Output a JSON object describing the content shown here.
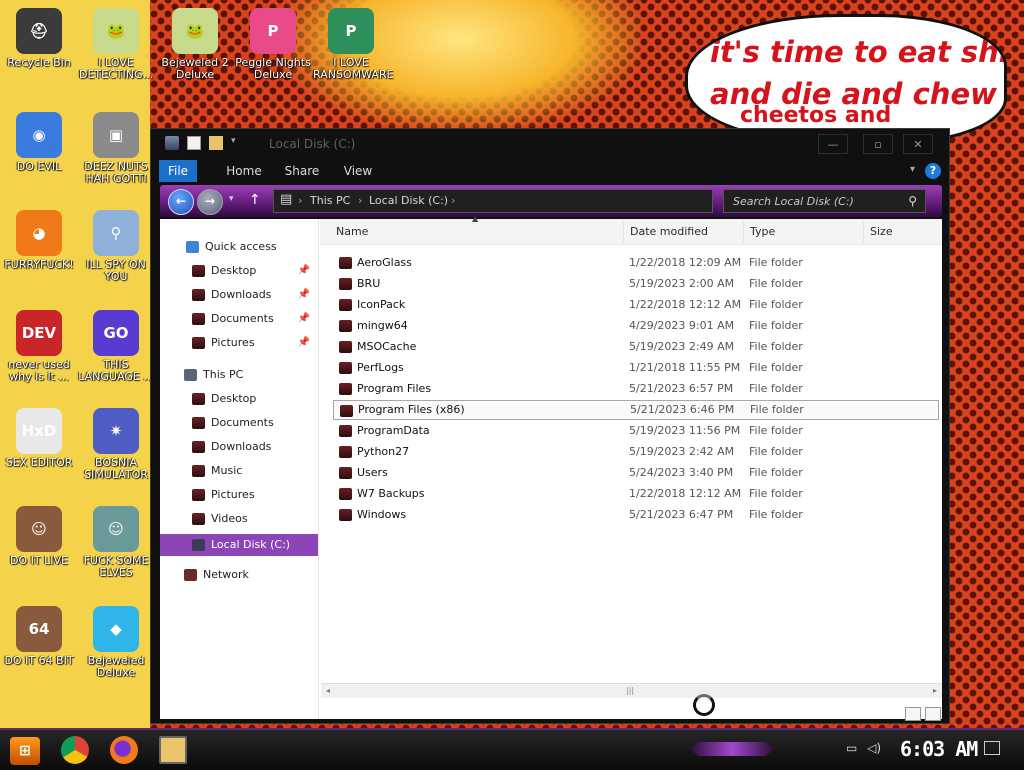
{
  "speech_bubble": {
    "line1": "it's time to eat shit",
    "line2": "and die and chew",
    "line3": "cheetos and"
  },
  "desktop_icons": [
    {
      "label": "Recycle Bin",
      "icon": "recycle-bin-icon",
      "color": "#3b3b3b",
      "glyph": "⛑"
    },
    {
      "label": "I LOVE DETECTING...",
      "icon": "frog-meme-icon",
      "color": "#c7d98a",
      "glyph": "🐸"
    },
    {
      "label": "Bejeweled 2 Deluxe",
      "icon": "bejeweled-icon",
      "color": "#c7d98a",
      "glyph": "🐸"
    },
    {
      "label": "Peggle Nights Deluxe",
      "icon": "peggle-icon",
      "color": "#e84a8a",
      "glyph": "P"
    },
    {
      "label": "I LOVE RANSOMWARE",
      "icon": "project-icon",
      "color": "#2f8f5a",
      "glyph": "P"
    },
    {
      "label": "DO EVIL",
      "icon": "chrome-icon",
      "color": "#3a7be0",
      "glyph": "◉"
    },
    {
      "label": "DEEZ NUTS HAH GOTTI",
      "icon": "window-stack-icon",
      "color": "#8a8a8a",
      "glyph": "▣"
    },
    {
      "label": "FURRYFUCK!",
      "icon": "firefox-icon",
      "color": "#f07a1a",
      "glyph": "◕"
    },
    {
      "label": "ILL SPY ON YOU",
      "icon": "magnifier-icon",
      "color": "#8fb0d8",
      "glyph": "⚲"
    },
    {
      "label": "never used why is it ...",
      "icon": "devcpp-icon",
      "color": "#c9262a",
      "glyph": "DEV"
    },
    {
      "label": "THIS LANGUAGE ...",
      "icon": "goland-icon",
      "color": "#5a3bd1",
      "glyph": "GO"
    },
    {
      "label": "SEX EDITOR",
      "icon": "hex-editor-icon",
      "color": "#e8e8e8",
      "glyph": "HxD"
    },
    {
      "label": "BOSNIA SIMULATOR",
      "icon": "mine-icon",
      "color": "#4e5cc4",
      "glyph": "✷"
    },
    {
      "label": "DO IT LIVE",
      "icon": "portrait-icon",
      "color": "#8a5a3c",
      "glyph": "☺"
    },
    {
      "label": "FUCK SOME ELVES",
      "icon": "santa-icon",
      "color": "#6a9a9a",
      "glyph": "☺"
    },
    {
      "label": "DO IT 64 BIT",
      "icon": "portrait-64-icon",
      "color": "#8a5a3c",
      "glyph": "64"
    },
    {
      "label": "Bejeweled Deluxe",
      "icon": "diamond-icon",
      "color": "#2fb5e8",
      "glyph": "◆"
    }
  ],
  "window": {
    "title": "Local Disk (C:)",
    "ribbon_tabs": [
      "File",
      "Home",
      "Share",
      "View"
    ],
    "breadcrumb": [
      "This PC",
      "Local Disk (C:)"
    ],
    "search_placeholder": "Search Local Disk (C:)",
    "controls": [
      "minimize",
      "maximize",
      "close"
    ]
  },
  "navigation": {
    "quick_access_label": "Quick access",
    "quick_access": [
      {
        "label": "Desktop",
        "pinned": true
      },
      {
        "label": "Downloads",
        "pinned": true
      },
      {
        "label": "Documents",
        "pinned": true
      },
      {
        "label": "Pictures",
        "pinned": true
      }
    ],
    "this_pc_label": "This PC",
    "this_pc": [
      "Desktop",
      "Documents",
      "Downloads",
      "Music",
      "Pictures",
      "Videos",
      "Local Disk (C:)"
    ],
    "network_label": "Network",
    "selected": "Local Disk (C:)"
  },
  "columns": [
    "Name",
    "Date modified",
    "Type",
    "Size"
  ],
  "files": [
    {
      "name": "AeroGlass",
      "date": "1/22/2018 12:09 AM",
      "type": "File folder"
    },
    {
      "name": "BRU",
      "date": "5/19/2023 2:00 AM",
      "type": "File folder"
    },
    {
      "name": "IconPack",
      "date": "1/22/2018 12:12 AM",
      "type": "File folder"
    },
    {
      "name": "mingw64",
      "date": "4/29/2023 9:01 AM",
      "type": "File folder"
    },
    {
      "name": "MSOCache",
      "date": "5/19/2023 2:49 AM",
      "type": "File folder"
    },
    {
      "name": "PerfLogs",
      "date": "1/21/2018 11:55 PM",
      "type": "File folder"
    },
    {
      "name": "Program Files",
      "date": "5/21/2023 6:57 PM",
      "type": "File folder"
    },
    {
      "name": "Program Files (x86)",
      "date": "5/21/2023 6:46 PM",
      "type": "File folder"
    },
    {
      "name": "ProgramData",
      "date": "5/19/2023 11:56 PM",
      "type": "File folder"
    },
    {
      "name": "Python27",
      "date": "5/19/2023 2:42 AM",
      "type": "File folder"
    },
    {
      "name": "Users",
      "date": "5/24/2023 3:40 PM",
      "type": "File folder"
    },
    {
      "name": "W7 Backups",
      "date": "1/22/2018 12:12 AM",
      "type": "File folder"
    },
    {
      "name": "Windows",
      "date": "5/21/2023 6:47 PM",
      "type": "File folder"
    }
  ],
  "selected_file": "Program Files (x86)",
  "taskbar": {
    "apps": [
      "chrome-icon",
      "firefox-icon",
      "file-explorer-icon"
    ],
    "clock": "6:03 AM",
    "tray": [
      "network-icon",
      "volume-icon"
    ],
    "colors": {
      "taskbar": "#111111",
      "accent": "#8b45b6"
    }
  }
}
